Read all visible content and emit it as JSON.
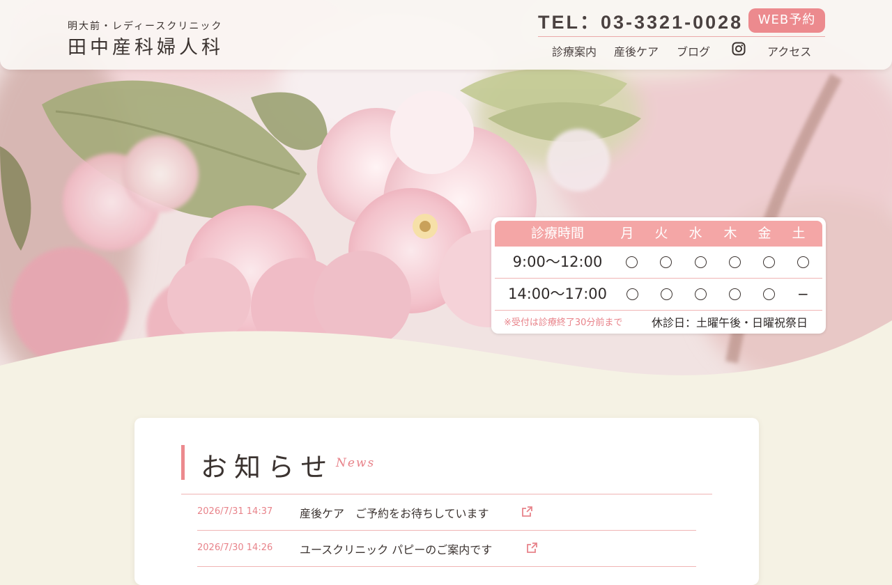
{
  "header": {
    "logo_small": "明大前・レディースクリニック",
    "logo_big": "田中産科婦人科",
    "tel": "TEL：03-3321-0028",
    "web_button": "WEB予約",
    "nav": [
      {
        "label": "診療案内"
      },
      {
        "label": "産後ケア"
      },
      {
        "label": "ブログ"
      },
      {
        "label": "アクセス"
      }
    ],
    "instagram_icon": "instagram-icon"
  },
  "hours": {
    "header_label": "診療時間",
    "days": [
      "月",
      "火",
      "水",
      "木",
      "金",
      "土"
    ],
    "rows": [
      {
        "time": "9:00〜12:00",
        "marks": [
          "○",
          "○",
          "○",
          "○",
          "○",
          "○"
        ]
      },
      {
        "time": "14:00〜17:00",
        "marks": [
          "○",
          "○",
          "○",
          "○",
          "○",
          "−"
        ]
      }
    ],
    "note": "※受付は診療終了30分前まで",
    "closed": "休診日：土曜午後・日曜祝祭日"
  },
  "news": {
    "title": "お知らせ",
    "subtitle": "News",
    "items": [
      {
        "date": "2026/7/31 14:37",
        "text": "産後ケア　ご予約をお待ちしています"
      },
      {
        "date": "2026/7/30 14:26",
        "text": "ユースクリニック パピーのご案内です"
      }
    ]
  },
  "colors": {
    "accent": "#ec8a8e",
    "pink_soft": "#f4a6a6",
    "cream": "#f5f2e4"
  }
}
